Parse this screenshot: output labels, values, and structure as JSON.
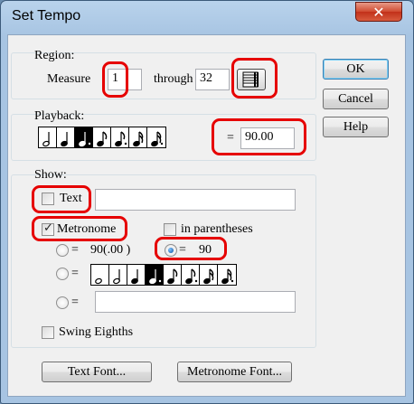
{
  "window": {
    "title": "Set Tempo",
    "close_label": "✕"
  },
  "region": {
    "heading": "Region:",
    "measure_label": "Measure",
    "measure_value": "1",
    "through_label": "through",
    "through_value": "32"
  },
  "playback": {
    "heading": "Playback:",
    "equals": "=",
    "tempo_value": "90.00",
    "notes": [
      "half",
      "quarter",
      "dotted-quarter",
      "eighth",
      "dotted-eighth",
      "sixteenth",
      "dotted-sixteenth"
    ],
    "selected_note_index": 2
  },
  "show": {
    "heading": "Show:",
    "text_label": "Text",
    "text_checked": false,
    "text_value": "",
    "metronome_label": "Metronome",
    "metronome_checked": true,
    "parentheses_label": "in parentheses",
    "parentheses_checked": false,
    "option1_equals": "=",
    "option1_value": "90(.00 )",
    "option2_equals": "=",
    "option2_value": "90",
    "option3_equals": "=",
    "option4_equals": "=",
    "option4_value": "",
    "selected_option": 2,
    "notes": [
      "whole",
      "half",
      "quarter",
      "dotted-quarter",
      "eighth",
      "dotted-eighth",
      "sixteenth",
      "dotted-sixteenth"
    ],
    "selected_note_index": 3,
    "swing_label": "Swing Eighths",
    "swing_checked": false
  },
  "buttons": {
    "ok": "OK",
    "cancel": "Cancel",
    "help": "Help",
    "text_font": "Text Font...",
    "metronome_font": "Metronome Font..."
  },
  "colors": {
    "highlight": "#e60000",
    "title_bg": "#a7c4e2",
    "close": "#c2311a"
  }
}
